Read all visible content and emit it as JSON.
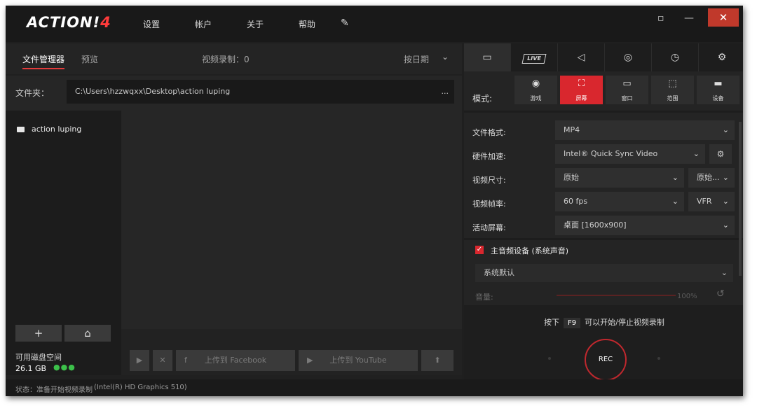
{
  "titlebar": {
    "logo_main": "ACTION!",
    "logo_version": "4",
    "menu": [
      "设置",
      "帐户",
      "关于",
      "帮助"
    ],
    "close": "✕",
    "minimize": "—"
  },
  "left": {
    "tabs": [
      "文件管理器",
      "预览"
    ],
    "record_count": "视频录制：0",
    "sort": "按日期",
    "folder_label": "文件夹：",
    "folder_path": "C:\\Users\\hzzwqxx\\Desktop\\action luping",
    "folder_more": "...",
    "tree_item": "action luping",
    "add_label": "+",
    "disk_label": "可用磁盘空间",
    "disk_value": "26.1 GB",
    "upload_facebook": "上传到 Facebook",
    "upload_youtube": "上传到 YouTube"
  },
  "right": {
    "mode_label": "模式:",
    "modes": [
      "游戏",
      "屏幕",
      "窗口",
      "范围",
      "设备"
    ],
    "live_label": "LIVE",
    "settings": {
      "format_label": "文件格式:",
      "format_value": "MP4",
      "accel_label": "硬件加速:",
      "accel_value": "Intel® Quick Sync Video",
      "size_label": "视频尺寸:",
      "size_value": "原始",
      "size_value2": "原始...",
      "fps_label": "视频帧率:",
      "fps_value": "60 fps",
      "fps_mode": "VFR",
      "screen_label": "活动屏幕:",
      "screen_value": "桌面 [1600x900]"
    },
    "audio_label": "主音频设备 (系统声音)",
    "audio_device": "系统默认",
    "volume_label": "音量:",
    "volume_pct": "100%",
    "hint_prefix": "按下",
    "hint_key": "F9",
    "hint_suffix": "可以开始/停止视频录制",
    "rec_label": "REC"
  },
  "status": {
    "left": "状态：准备开始视频录制",
    "right": "(Intel(R) HD Graphics 510)"
  },
  "colors": {
    "accent": "#d9272e",
    "background": "#1f1f1f"
  }
}
